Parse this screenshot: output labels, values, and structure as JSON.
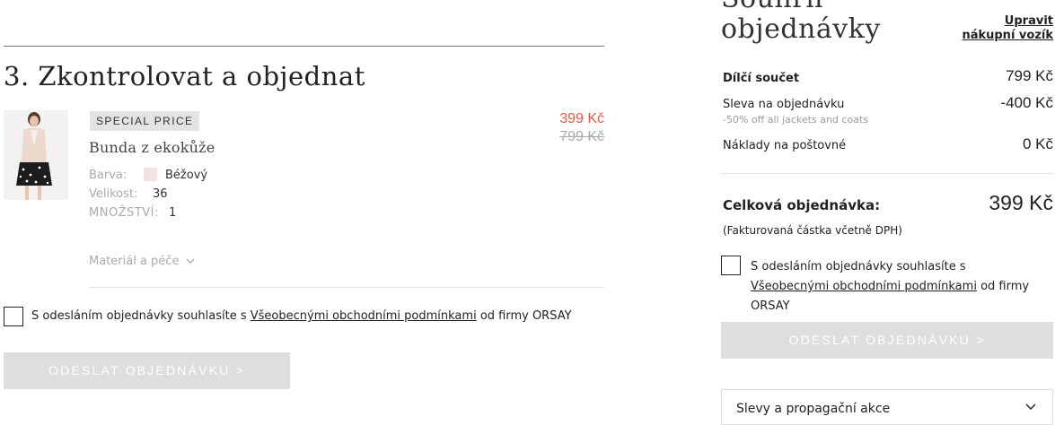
{
  "checkout": {
    "step_title": "3. Zkontrolovat a objednat",
    "item": {
      "badge": "SPECIAL PRICE",
      "name": "Bunda z ekokůže",
      "color_label": "Barva:",
      "color_value": "Béžový",
      "color_hex": "#f1e3e1",
      "size_label": "Velikost:",
      "size_value": "36",
      "qty_label": "MNOŽSTVÍ:",
      "qty_value": "1",
      "material_label": "Materiál a péče",
      "price_new": "399 Kč",
      "price_old": "799 Kč"
    },
    "terms": {
      "prefix": "S odesláním objednávky souhlasíte s ",
      "link": "Všeobecnými obchodními podmínkami",
      "suffix": " od firmy ORSAY"
    },
    "submit_label": "ODESLAT OBJEDNÁVKU >"
  },
  "summary": {
    "title_line1": "Souhrn",
    "title_line2": "objednávky",
    "edit_link": "Upravit nákupní vozík",
    "subtotal_label": "Dílčí součet",
    "subtotal_value": "799 Kč",
    "discount_label": "Sleva na objednávku",
    "discount_note": "-50% off all jackets and coats",
    "discount_value": "-400 Kč",
    "shipping_label": "Náklady na poštovné",
    "shipping_value": "0 Kč",
    "total_label": "Celková objednávka:",
    "total_value": "399 Kč",
    "vat_note": "(Fakturovaná částka včetně DPH)",
    "terms": {
      "prefix": "S odesláním objednávky souhlasíte s ",
      "link": "Všeobecnými obchodními podmínkami",
      "suffix": " od firmy ORSAY"
    },
    "submit_label": "ODESLAT OBJEDNÁVKU >",
    "promo_label": "Slevy a propagační akce"
  },
  "colors": {
    "price_accent": "#e05a48",
    "button_disabled": "#dedede"
  }
}
